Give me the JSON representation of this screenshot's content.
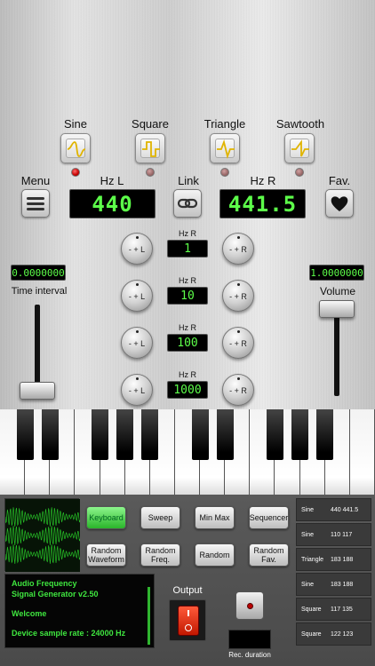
{
  "waveforms": [
    {
      "label": "Sine",
      "led": "on"
    },
    {
      "label": "Square",
      "led": "off"
    },
    {
      "label": "Triangle",
      "led": "off"
    },
    {
      "label": "Sawtooth",
      "led": "off"
    }
  ],
  "header": {
    "menu_label": "Menu",
    "hz_l_label": "Hz L",
    "link_label": "Link",
    "hz_r_label": "Hz R",
    "fav_label": "Fav.",
    "hz_l_value": "440",
    "hz_r_value": "441.5"
  },
  "steps": [
    {
      "label": "Hz R",
      "value": "1",
      "minus_plus_l": "- + L",
      "minus_plus_r": "- + R"
    },
    {
      "label": "Hz R",
      "value": "10",
      "minus_plus_l": "- + L",
      "minus_plus_r": "- + R"
    },
    {
      "label": "Hz R",
      "value": "100",
      "minus_plus_l": "- + L",
      "minus_plus_r": "- + R"
    },
    {
      "label": "Hz R",
      "value": "1000",
      "minus_plus_l": "- + L",
      "minus_plus_r": "- + R"
    }
  ],
  "time_interval": {
    "label": "Time interval",
    "value": "0.0000000",
    "level": 0.0
  },
  "volume": {
    "label": "Volume",
    "value": "1.0000000",
    "level": 1.0
  },
  "controls": {
    "keyboard": "Keyboard",
    "sweep": "Sweep",
    "minmax": "Min Max",
    "sequencer": "Sequencer",
    "random_waveform": "Random Waveform",
    "random_freq": "Random Freq.",
    "random": "Random",
    "random_fav": "Random Fav."
  },
  "info": {
    "title1": "Audio Frequency",
    "title2": "Signal Generator v2.50",
    "welcome": "Welcome",
    "device": "Device sample rate : 24000 Hz"
  },
  "output": {
    "label": "Output"
  },
  "record": {
    "label": "Rec. duration"
  },
  "favorites": [
    {
      "wave": "Sine",
      "freqs": "440 441.5"
    },
    {
      "wave": "Sine",
      "freqs": "110 117"
    },
    {
      "wave": "Triangle",
      "freqs": "183 188"
    },
    {
      "wave": "Sine",
      "freqs": "183 188"
    },
    {
      "wave": "Square",
      "freqs": "117 135"
    },
    {
      "wave": "Square",
      "freqs": "122 123"
    }
  ],
  "colors": {
    "lcd_green": "#5dff4a",
    "active_green": "#2bb52b",
    "led_red": "#c40000"
  }
}
